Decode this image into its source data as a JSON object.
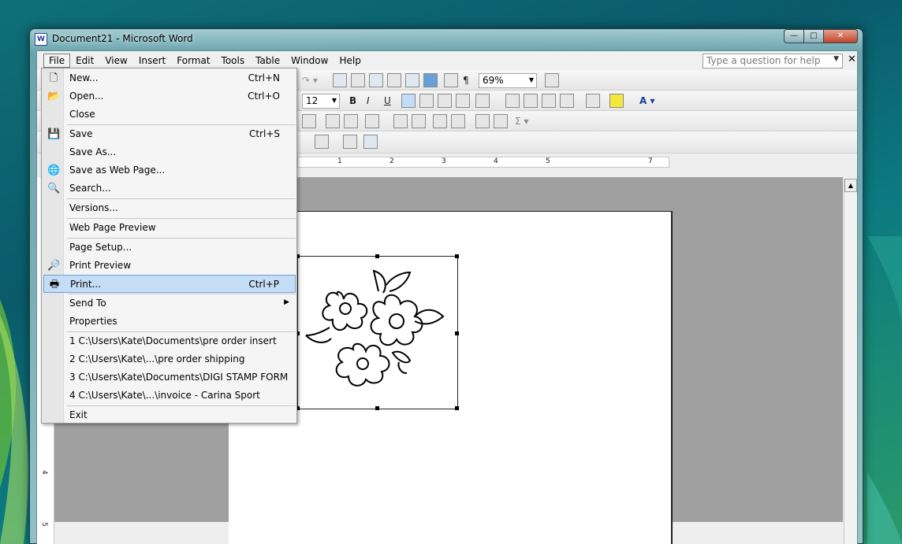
{
  "window": {
    "title": "Document21 - Microsoft Word",
    "icon_name": "word-app-icon"
  },
  "menubar": {
    "items": [
      "File",
      "Edit",
      "View",
      "Insert",
      "Format",
      "Tools",
      "Table",
      "Window",
      "Help"
    ],
    "active": "File",
    "help_placeholder": "Type a question for help"
  },
  "toolbar": {
    "zoom": "69%",
    "font_size": "12"
  },
  "file_menu": {
    "items": [
      {
        "label": "New...",
        "shortcut": "Ctrl+N",
        "icon": "new-document-icon"
      },
      {
        "label": "Open...",
        "shortcut": "Ctrl+O",
        "icon": "open-folder-icon"
      },
      {
        "label": "Close",
        "shortcut": "",
        "icon": ""
      },
      {
        "label": "Save",
        "shortcut": "Ctrl+S",
        "icon": "save-icon"
      },
      {
        "label": "Save As...",
        "shortcut": "",
        "icon": ""
      },
      {
        "label": "Save as Web Page...",
        "shortcut": "",
        "icon": "save-web-icon"
      },
      {
        "label": "Search...",
        "shortcut": "",
        "icon": "search-icon"
      },
      {
        "label": "Versions...",
        "shortcut": "",
        "icon": ""
      },
      {
        "label": "Web Page Preview",
        "shortcut": "",
        "icon": ""
      },
      {
        "label": "Page Setup...",
        "shortcut": "",
        "icon": ""
      },
      {
        "label": "Print Preview",
        "shortcut": "",
        "icon": "print-preview-icon"
      },
      {
        "label": "Print...",
        "shortcut": "Ctrl+P",
        "icon": "printer-icon"
      },
      {
        "label": "Send To",
        "shortcut": "",
        "icon": ""
      },
      {
        "label": "Properties",
        "shortcut": "",
        "icon": ""
      },
      {
        "label": "1 C:\\Users\\Kate\\Documents\\pre order insert",
        "shortcut": "",
        "icon": ""
      },
      {
        "label": "2 C:\\Users\\Kate\\...\\pre order shipping",
        "shortcut": "",
        "icon": ""
      },
      {
        "label": "3 C:\\Users\\Kate\\Documents\\DIGI STAMP FORM",
        "shortcut": "",
        "icon": ""
      },
      {
        "label": "4 C:\\Users\\Kate\\...\\invoice - Carina Sport",
        "shortcut": "",
        "icon": ""
      },
      {
        "label": "Exit",
        "shortcut": "",
        "icon": ""
      }
    ],
    "highlighted": "Print..."
  },
  "ruler": {
    "numbers": [
      "1",
      "2",
      "3",
      "4",
      "5",
      "7"
    ]
  },
  "vertical_ruler": {
    "numbers": [
      "4",
      "5"
    ]
  }
}
